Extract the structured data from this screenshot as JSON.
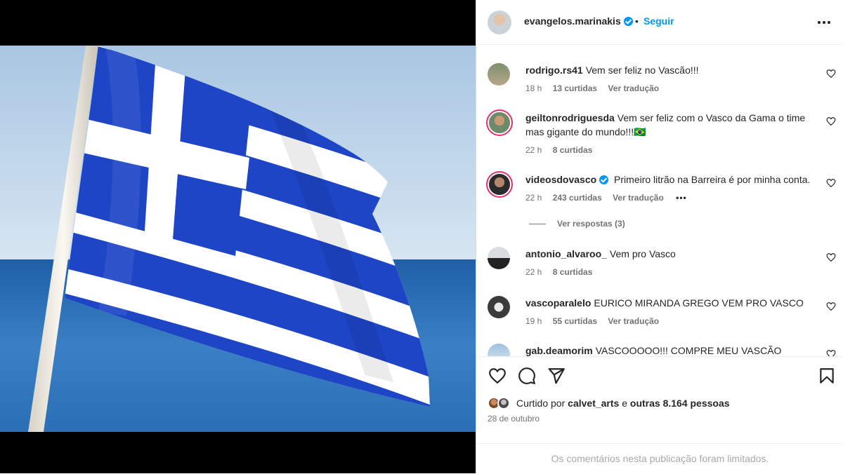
{
  "post": {
    "username": "evangelos.marinakis",
    "separator": "•",
    "follow_label": "Seguir",
    "more_icon": "more-horizontal-icon",
    "image_subject": "flag-of-greece"
  },
  "comments": [
    {
      "username": "rodrigo.rs41",
      "verified": false,
      "text": "Vem ser feliz no Vascão!!!",
      "time": "18 h",
      "likes": "13 curtidas",
      "translate": "Ver tradução"
    },
    {
      "username": "geiltonrodriguesda",
      "verified": false,
      "text": "Vem ser feliz com o Vasco da Gama o time mas gigante do mundo!!!🇧🇷",
      "time": "22 h",
      "likes": "8 curtidas",
      "translate": ""
    },
    {
      "username": "videosdovasco",
      "verified": true,
      "text": "Primeiro litrão na Barreira é por minha conta.",
      "time": "22 h",
      "likes": "243 curtidas",
      "translate": "Ver tradução",
      "replies": "Ver respostas (3)"
    },
    {
      "username": "antonio_alvaroo_",
      "verified": false,
      "text": "Vem pro Vasco",
      "time": "22 h",
      "likes": "8 curtidas",
      "translate": ""
    },
    {
      "username": "vascoparalelo",
      "verified": false,
      "text": "EURICO MIRANDA GREGO VEM PRO VASCO",
      "time": "19 h",
      "likes": "55 curtidas",
      "translate": "Ver tradução"
    },
    {
      "username": "gab.deamorim",
      "verified": false,
      "text": "VASCOOOOO!!! COMPRE MEU VASCÃO",
      "time": "",
      "likes": "",
      "translate": ""
    }
  ],
  "likes": {
    "prefix": "Curtido por",
    "user": "calvet_arts",
    "middle": "e",
    "others": "outras 8.164 pessoas"
  },
  "date": "28 de outubro",
  "limited_notice": "Os comentários nesta publicação foram limitados.",
  "icons": {
    "like": "heart-icon",
    "comment": "comment-icon",
    "share": "send-icon",
    "save": "bookmark-icon"
  },
  "colors": {
    "accent": "#0095f6",
    "flag_blue": "#1d45c6",
    "flag_white": "#ffffff",
    "sky": "#b9d3ea",
    "sea": "#2d72b8"
  }
}
